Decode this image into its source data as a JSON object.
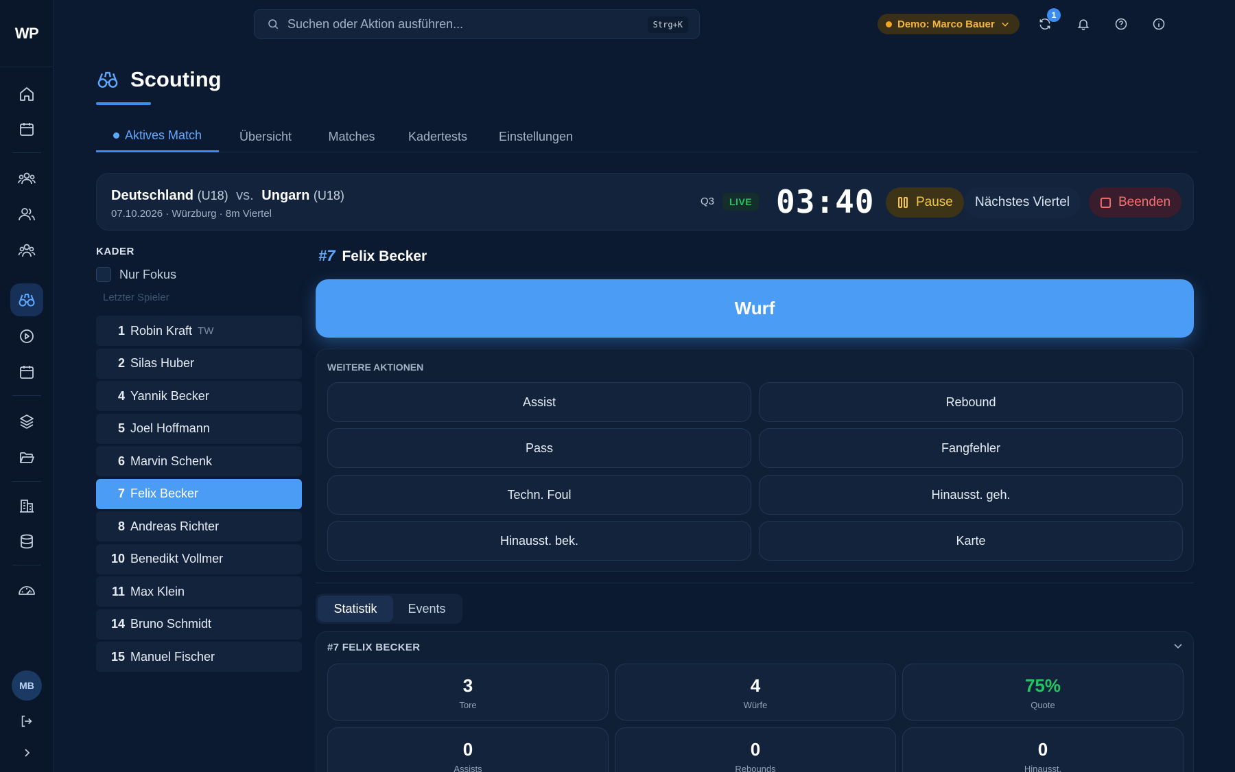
{
  "app": {
    "logo": "WP"
  },
  "search": {
    "placeholder": "Suchen oder Aktion ausführen...",
    "shortcut": "Strg+K"
  },
  "topbar": {
    "demo_label": "Demo: Marco Bauer",
    "sync_badge": "1",
    "avatar": "MB"
  },
  "sidebar": {
    "avatar": "MB"
  },
  "page": {
    "title": "Scouting"
  },
  "tabs": [
    "Aktives Match",
    "Übersicht",
    "Matches",
    "Kadertests",
    "Einstellungen"
  ],
  "match": {
    "home": "Deutschland",
    "home_age": "(U18)",
    "vs": "vs.",
    "away": "Ungarn",
    "away_age": "(U18)",
    "info": "07.10.2026 · Würzburg · 8m Viertel",
    "quarter": "Q3",
    "live": "LIVE",
    "clock": "03:40",
    "pause": "Pause",
    "next": "Nächstes Viertel",
    "end": "Beenden"
  },
  "kader": {
    "title": "KADER",
    "focus_label": "Nur Fokus",
    "last_player": "Letzter Spieler",
    "players": [
      {
        "num": "1",
        "name": "Robin Kraft",
        "role": "TW"
      },
      {
        "num": "2",
        "name": "Silas Huber",
        "role": ""
      },
      {
        "num": "4",
        "name": "Yannik Becker",
        "role": ""
      },
      {
        "num": "5",
        "name": "Joel Hoffmann",
        "role": ""
      },
      {
        "num": "6",
        "name": "Marvin Schenk",
        "role": ""
      },
      {
        "num": "7",
        "name": "Felix Becker",
        "role": ""
      },
      {
        "num": "8",
        "name": "Andreas Richter",
        "role": ""
      },
      {
        "num": "10",
        "name": "Benedikt Vollmer",
        "role": ""
      },
      {
        "num": "11",
        "name": "Max Klein",
        "role": ""
      },
      {
        "num": "14",
        "name": "Bruno Schmidt",
        "role": ""
      },
      {
        "num": "15",
        "name": "Manuel Fischer",
        "role": ""
      }
    ],
    "selected_index": 5
  },
  "selected": {
    "num": "#7",
    "name": "Felix Becker"
  },
  "actions": {
    "primary": "Wurf",
    "more_title": "WEITERE AKTIONEN",
    "items": [
      "Assist",
      "Rebound",
      "Pass",
      "Fangfehler",
      "Techn. Foul",
      "Hinausst. geh.",
      "Hinausst. bek.",
      "Karte"
    ]
  },
  "subtabs": [
    "Statistik",
    "Events"
  ],
  "stats": {
    "title": "#7 FELIX BECKER",
    "items": [
      {
        "value": "3",
        "label": "Tore"
      },
      {
        "value": "4",
        "label": "Würfe"
      },
      {
        "value": "75%",
        "label": "Quote"
      },
      {
        "value": "0",
        "label": "Assists"
      },
      {
        "value": "0",
        "label": "Rebounds"
      },
      {
        "value": "0",
        "label": "Hinausst."
      }
    ]
  },
  "colors": {
    "accent": "#4a9cf5",
    "live": "#22c55e",
    "pause": "#f5c542",
    "end": "#f87171",
    "demo": "#f5b53b"
  }
}
